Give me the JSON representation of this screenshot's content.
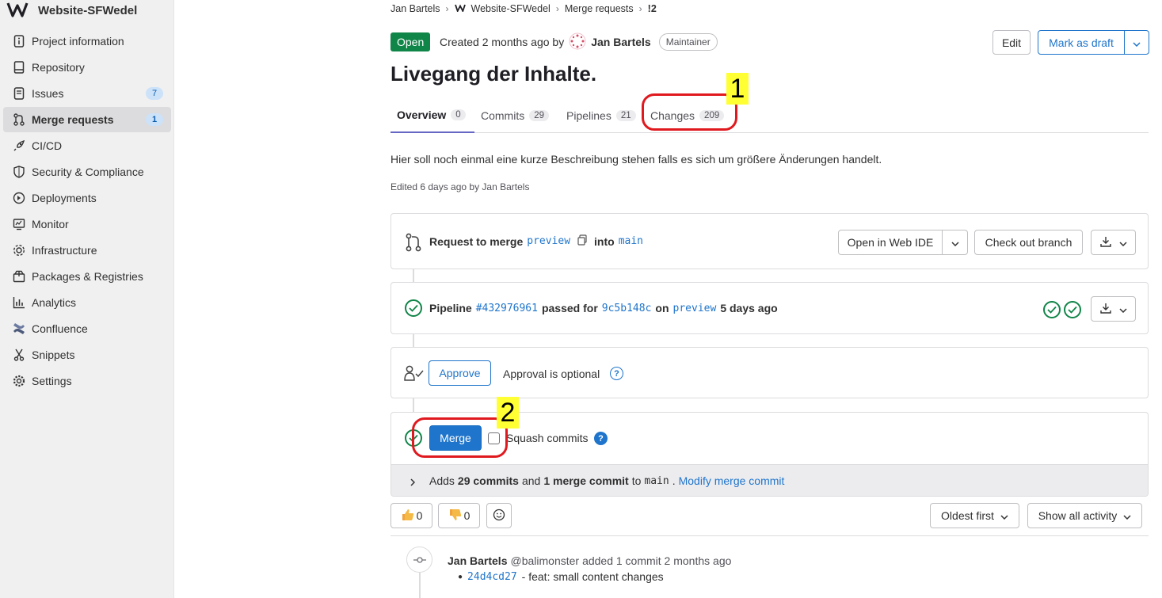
{
  "sidebar": {
    "project_name": "Website-SFWedel",
    "items": [
      {
        "label": "Project information",
        "icon": "info-doc-icon"
      },
      {
        "label": "Repository",
        "icon": "repository-icon"
      },
      {
        "label": "Issues",
        "icon": "issues-icon",
        "count": "7"
      },
      {
        "label": "Merge requests",
        "icon": "merge-request-icon",
        "count": "1",
        "active": true
      },
      {
        "label": "CI/CD",
        "icon": "rocket-icon"
      },
      {
        "label": "Security & Compliance",
        "icon": "shield-icon"
      },
      {
        "label": "Deployments",
        "icon": "deployments-icon"
      },
      {
        "label": "Monitor",
        "icon": "monitor-icon"
      },
      {
        "label": "Infrastructure",
        "icon": "cloud-gear-icon"
      },
      {
        "label": "Packages & Registries",
        "icon": "package-icon"
      },
      {
        "label": "Analytics",
        "icon": "chart-icon"
      },
      {
        "label": "Confluence",
        "icon": "confluence-icon"
      },
      {
        "label": "Snippets",
        "icon": "snippet-icon"
      },
      {
        "label": "Settings",
        "icon": "settings-gear-icon"
      }
    ]
  },
  "breadcrumb": {
    "user": "Jan Bartels",
    "project": "Website-SFWedel",
    "section": "Merge requests",
    "current": "!2"
  },
  "header": {
    "status": "Open",
    "created_text": "Created 2 months ago by",
    "author": "Jan Bartels",
    "role": "Maintainer",
    "edit_label": "Edit",
    "draft_label": "Mark as draft",
    "title": "Livegang der Inhalte."
  },
  "tabs": [
    {
      "label": "Overview",
      "count": "0"
    },
    {
      "label": "Commits",
      "count": "29"
    },
    {
      "label": "Pipelines",
      "count": "21"
    },
    {
      "label": "Changes",
      "count": "209"
    }
  ],
  "description": "Hier soll noch einmal eine kurze Beschreibung stehen falls es sich um größere Änderungen handelt.",
  "edited_text": "Edited 6 days ago by Jan Bartels",
  "merge_request": {
    "request_text": "Request to merge",
    "source_branch": "preview",
    "into_text": "into",
    "target_branch": "main",
    "web_ide_label": "Open in Web IDE",
    "checkout_label": "Check out branch"
  },
  "pipeline": {
    "label": "Pipeline",
    "id": "#432976961",
    "passed_for": "passed for",
    "commit": "9c5b148c",
    "on_text": "on",
    "branch": "preview",
    "when": "5 days ago"
  },
  "approval": {
    "button": "Approve",
    "text": "Approval is optional"
  },
  "merge": {
    "button": "Merge",
    "squash_label": "Squash commits",
    "adds_text": "Adds",
    "commits_count": "29 commits",
    "and_text": "and",
    "merge_commits": "1 merge commit",
    "to_text": "to",
    "target": "main",
    "modify_link": "Modify merge commit"
  },
  "reactions": {
    "thumbs_up": "0",
    "thumbs_down": "0"
  },
  "sort_label": "Oldest first",
  "filter_label": "Show all activity",
  "activity": {
    "author": "Jan Bartels",
    "handle": "@balimonster",
    "action": "added 1 commit 2 months ago",
    "commit_sha": "24d4cd27",
    "commit_msg": "- feat: small content changes"
  },
  "annotations": {
    "one": "1",
    "two": "2",
    "color": "#e0191f",
    "label_bg": "#ffff33"
  },
  "colors": {
    "accent": "#1f75cb",
    "success": "#108548",
    "tab_underline": "#6666c4"
  }
}
